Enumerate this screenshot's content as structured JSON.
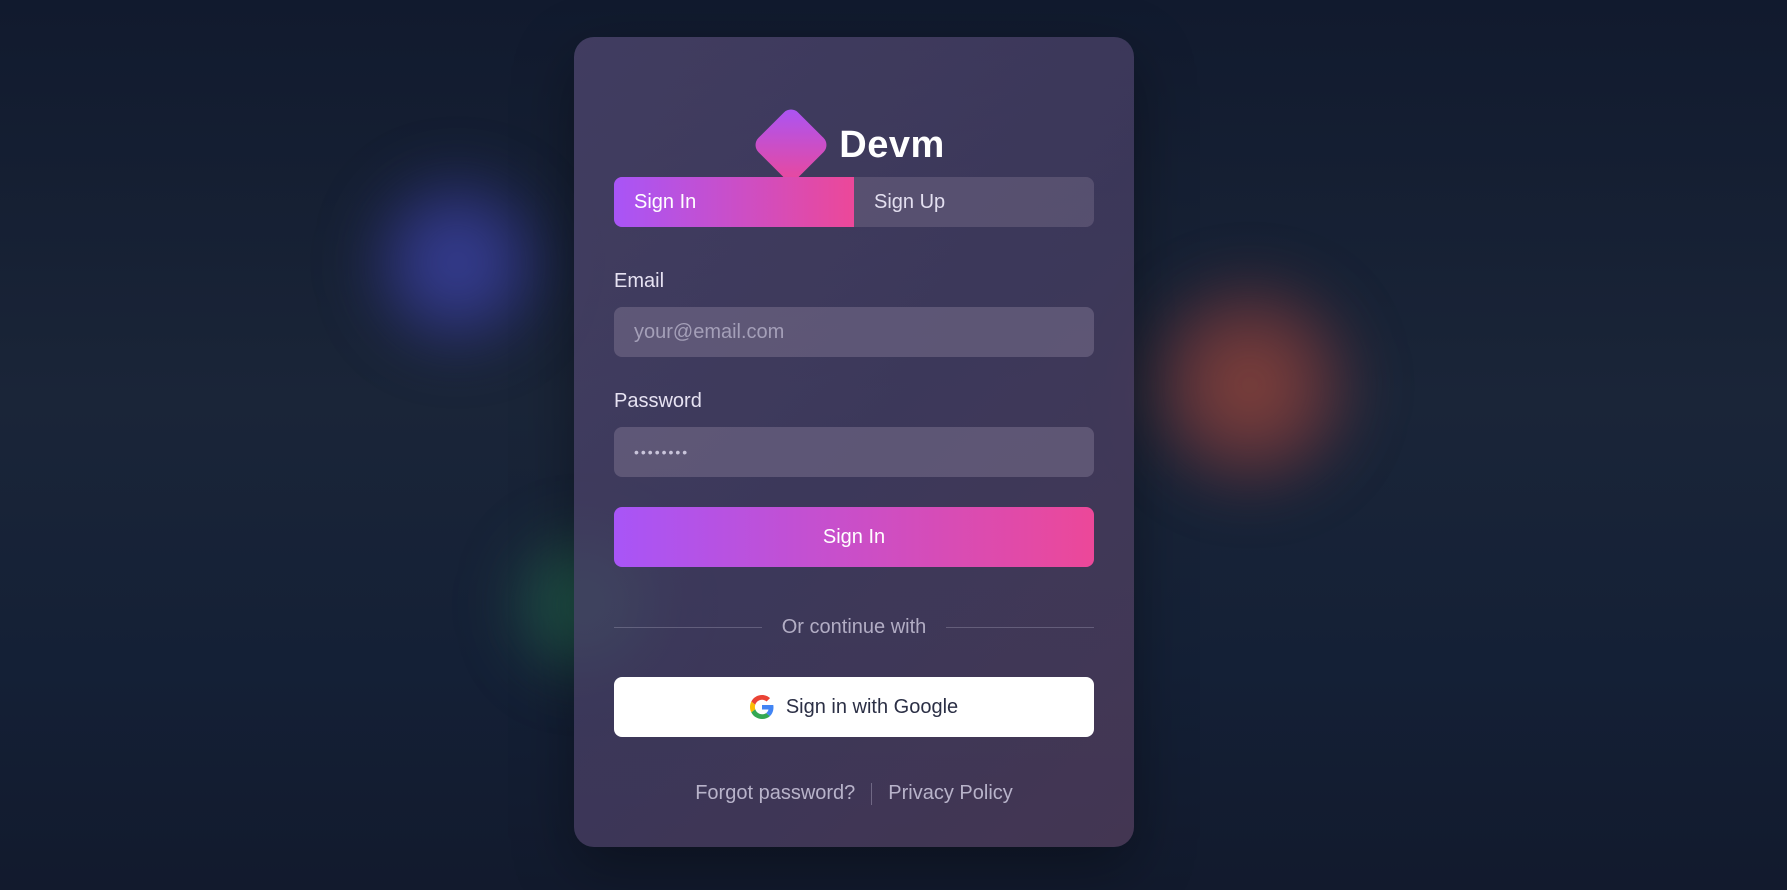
{
  "brand": {
    "name": "Devm",
    "logo_icon": "diamond-logo-icon",
    "gradient": [
      "#a855f7",
      "#ec4899"
    ]
  },
  "tabs": [
    {
      "label": "Sign In",
      "active": true
    },
    {
      "label": "Sign Up",
      "active": false
    }
  ],
  "form": {
    "email_label": "Email",
    "email_placeholder": "your@email.com",
    "email_value": "",
    "password_label": "Password",
    "password_value": "••••••••",
    "submit_label": "Sign In"
  },
  "divider_text": "Or continue with",
  "google": {
    "label": "Sign in with Google",
    "icon": "google-icon"
  },
  "footer": {
    "forgot_label": "Forgot password?",
    "privacy_label": "Privacy Policy"
  },
  "colors": {
    "accent_start": "#a855f7",
    "accent_end": "#ec4899",
    "background": "#141d30"
  }
}
